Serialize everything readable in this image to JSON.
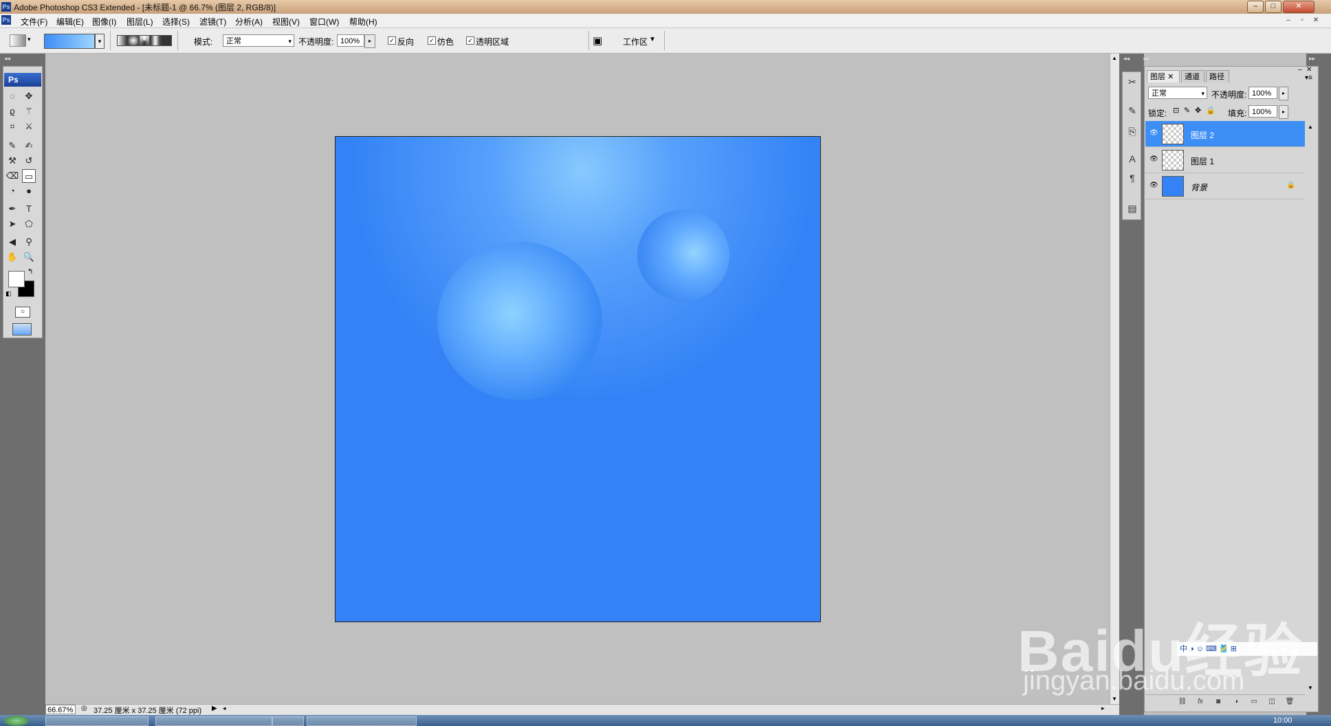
{
  "window": {
    "title": "Adobe Photoshop CS3 Extended - [未标题-1 @ 66.7% (图层 2, RGB/8)]",
    "app_icon": "Ps",
    "minimize": "–",
    "maximize": "□",
    "close": "✕"
  },
  "menu": {
    "items": [
      "文件(F)",
      "编辑(E)",
      "图像(I)",
      "图层(L)",
      "选择(S)",
      "滤镜(T)",
      "分析(A)",
      "视图(V)",
      "窗口(W)",
      "帮助(H)"
    ],
    "doc_min": "–",
    "doc_restore": "▫",
    "doc_close": "✕"
  },
  "options": {
    "mode_label": "模式:",
    "mode_value": "正常",
    "opacity_label": "不透明度:",
    "opacity_value": "100%",
    "reverse_label": "反向",
    "dither_label": "仿色",
    "transparency_label": "透明区域",
    "workspace_label": "工作区",
    "gradient_colors": [
      "#3d8ef5",
      "#9fd4ff"
    ]
  },
  "toolbox": {
    "logo": "Ps"
  },
  "document": {
    "background_color": "#3482f6",
    "highlight_color": "#8ccdff"
  },
  "status": {
    "zoom": "66.67%",
    "doc_size": "37.25 厘米 x 37.25 厘米 (72 ppi)"
  },
  "layers_panel": {
    "tabs": [
      "图层",
      "通道",
      "路径"
    ],
    "blend_mode": "正常",
    "opacity_label": "不透明度:",
    "opacity_value": "100%",
    "lock_label": "锁定:",
    "fill_label": "填充:",
    "fill_value": "100%",
    "layers": [
      {
        "name": "图层 2",
        "selected": true
      },
      {
        "name": "图层 1",
        "selected": false
      },
      {
        "name": "背景",
        "selected": false,
        "locked": true
      }
    ]
  },
  "taskbar": {
    "clock": "10:00"
  },
  "watermark": {
    "brand": "Baidu经验",
    "url": "jingyan.baidu.com",
    "ime": "中 ◑ ☺ ⌨ 🎽 ⊞"
  }
}
